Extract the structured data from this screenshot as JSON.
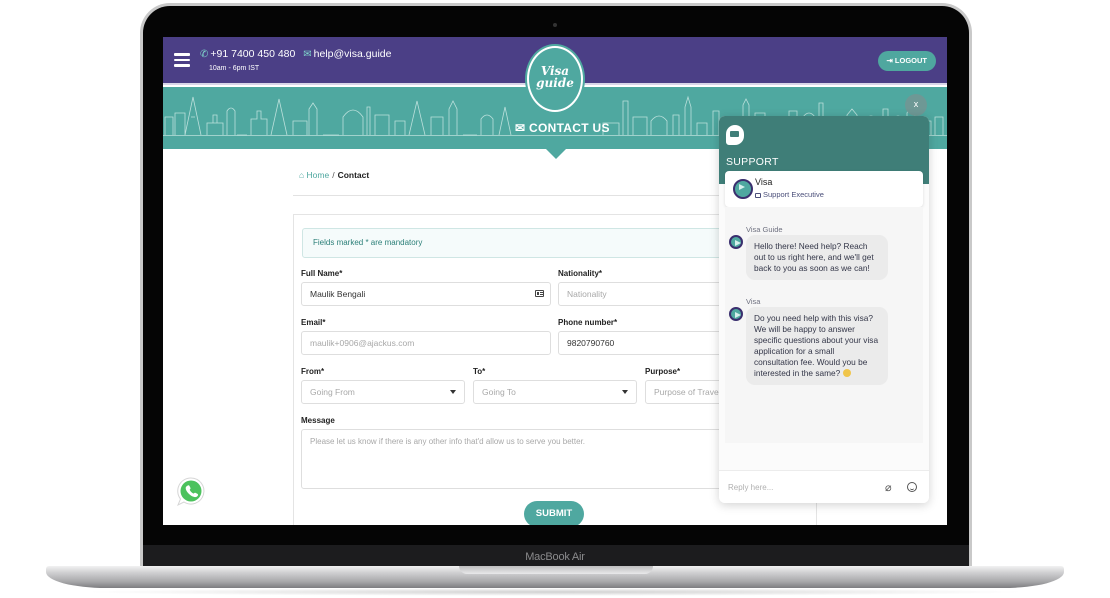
{
  "device": {
    "label": "MacBook Air"
  },
  "header": {
    "phone": "+91 7400 450 480",
    "email": "help@visa.guide",
    "hours": "10am - 6pm IST",
    "logo_line1": "Visa",
    "logo_line2": "guide",
    "logout_label": "⇥ LOGOUT"
  },
  "hero": {
    "title": "CONTACT US"
  },
  "breadcrumb": {
    "home": "Home",
    "separator": "/",
    "current": "Contact"
  },
  "form": {
    "notice": "Fields marked * are mandatory",
    "full_name": {
      "label": "Full Name*",
      "value": "Maulik Bengali"
    },
    "nationality": {
      "label": "Nationality*",
      "placeholder": "Nationality"
    },
    "email": {
      "label": "Email*",
      "value": "maulik+0906@ajackus.com"
    },
    "phone": {
      "label": "Phone number*",
      "value": "9820790760"
    },
    "from": {
      "label": "From*",
      "placeholder": "Going From"
    },
    "to": {
      "label": "To*",
      "placeholder": "Going To"
    },
    "purpose": {
      "label": "Purpose*",
      "placeholder": "Purpose of Travel"
    },
    "message": {
      "label": "Message",
      "placeholder": "Please let us know if there is any other info that'd allow us to serve you better."
    },
    "submit_label": "SUBMIT"
  },
  "chat": {
    "close_label": "x",
    "title": "SUPPORT",
    "agent_name": "Visa",
    "agent_role": "Support Executive",
    "messages": [
      {
        "sender": "Visa Guide",
        "text": "Hello there! Need help? Reach out to us right here, and we'll get back to you as soon as we can!"
      },
      {
        "sender": "Visa",
        "text": "Do you need help with this visa? We will be happy to answer specific questions about your visa application for a small consultation fee. Would you be interested in the same?"
      }
    ],
    "reply_placeholder": "Reply here..."
  },
  "colors": {
    "header_purple": "#4b3f86",
    "teal": "#4fa8a0",
    "chat_teal": "#3f7e78"
  }
}
